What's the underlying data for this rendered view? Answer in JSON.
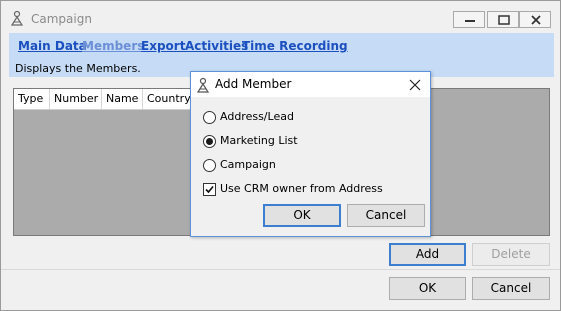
{
  "window": {
    "title": "Campaign"
  },
  "nav": {
    "links": [
      "Main Data",
      "Members",
      "Export",
      "Activities",
      "Time Recording"
    ],
    "active": "Members",
    "description": "Displays the Members."
  },
  "grid": {
    "columns": [
      "Type",
      "Number",
      "Name",
      "Country"
    ]
  },
  "members_buttons": {
    "add": "Add",
    "delete": "Delete"
  },
  "footer": {
    "ok": "OK",
    "cancel": "Cancel"
  },
  "dialog": {
    "title": "Add Member",
    "options": [
      {
        "label": "Address/Lead",
        "checked": false
      },
      {
        "label": "Marketing List",
        "checked": true
      },
      {
        "label": "Campaign",
        "checked": false
      }
    ],
    "checkbox": {
      "label": "Use CRM owner from Address",
      "checked": true
    },
    "ok": "OK",
    "cancel": "Cancel"
  },
  "colors": {
    "nav_band": "#c6dcf6",
    "link": "#1c4fbf",
    "dialog_border": "#5b92d9",
    "grid_bg": "#ababab"
  }
}
